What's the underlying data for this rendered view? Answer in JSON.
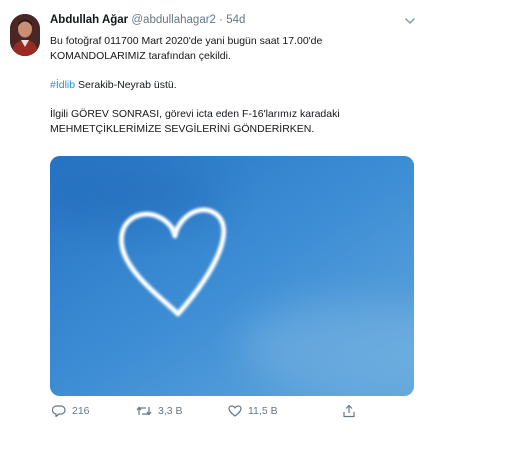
{
  "tweet": {
    "author_name": "Abdullah Ağar",
    "handle": "@abdullahagar2",
    "separator": "·",
    "time": "54d",
    "line1": "Bu fotoğraf 011700 Mart 2020'de yani bugün saat 17.00'de",
    "line2": "KOMANDOLARIMIZ tarafından çekildi.",
    "hashtag": "#İdlib",
    "location_text": " Serakib-Neyrab üstü.",
    "line4": "İlgili GÖREV SONRASI, görevi icta eden F-16'larımız karadaki",
    "line5": "MEHMETÇİKLERİMİZE SEVGİLERİNİ GÖNDERİRKEN."
  },
  "media": {
    "description_icon": "heart-contrail-photo",
    "sky_color": "#3a8ad4"
  },
  "actions": {
    "reply_count": "216",
    "retweet_count": "3,3 B",
    "like_count": "11,5 B"
  },
  "colors": {
    "text": "#14171a",
    "secondary": "#657786",
    "link": "#1b95e0"
  }
}
